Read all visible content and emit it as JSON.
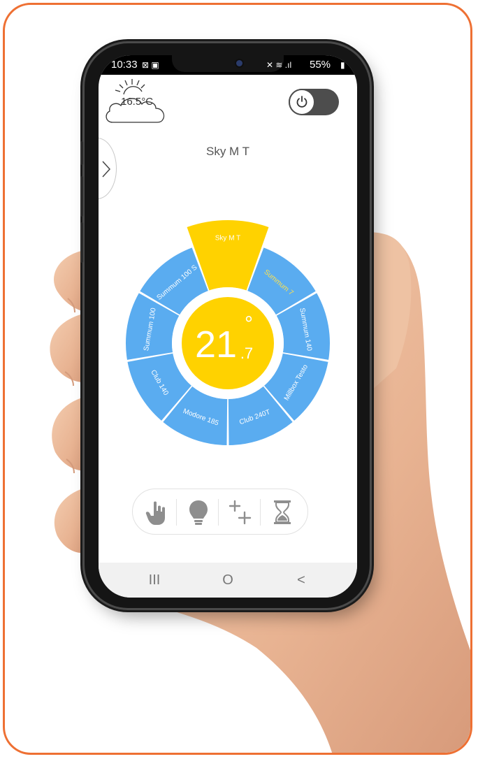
{
  "status_bar": {
    "time": "10:33",
    "battery": "55%"
  },
  "weather": {
    "temperature": "16.5°C",
    "icon": "cloud-sun-icon"
  },
  "power": {
    "icon": "power-icon",
    "state": "on"
  },
  "drawer": {
    "icon": "chevron-right-icon"
  },
  "device_title": "Sky M T",
  "wheel": {
    "center_value": "21",
    "center_decimal": ".7",
    "center_unit": "°",
    "selected_segment": "Sky M T",
    "segments": [
      "Summum 7",
      "Summum 140",
      "Millbox Testo",
      "Club 240T",
      "Modore 185",
      "Club 140",
      "Summum 100",
      "Summum 100 S"
    ],
    "colors": {
      "ring": "#5aacf0",
      "selected": "#ffd200",
      "center": "#ffd200",
      "highlight_text": "#ffe24d"
    }
  },
  "icon_bar": {
    "items": [
      "hand-icon",
      "bulb-icon",
      "plus-plus-icon",
      "hourglass-icon"
    ]
  },
  "nav_bar": {
    "recents": "III",
    "home": "O",
    "back": "<"
  }
}
